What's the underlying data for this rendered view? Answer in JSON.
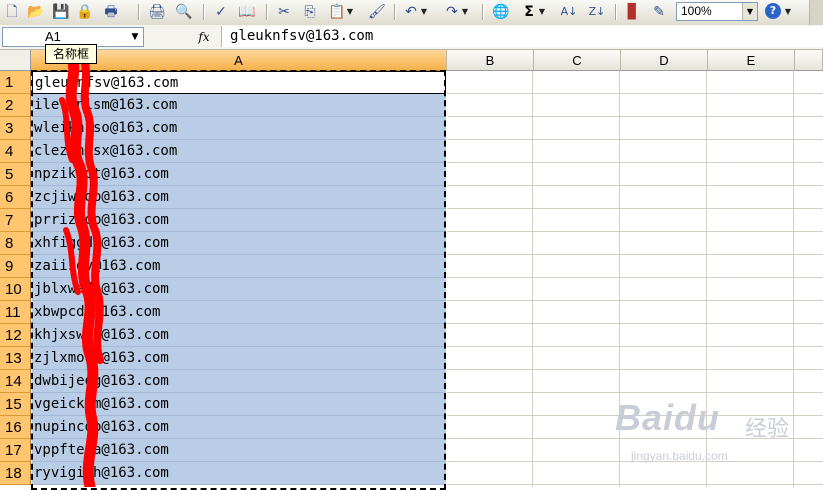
{
  "toolbar": {
    "zoom_value": "100%",
    "help_icon": "help-icon",
    "icons": [
      "new-icon",
      "open-icon",
      "save-icon",
      "permission-icon",
      "print-preview-icon",
      "print-icon",
      "preview-icon",
      "spelling-icon",
      "research-icon",
      "cut-icon",
      "copy-icon",
      "paste-icon",
      "format-painter-icon",
      "undo-icon",
      "redo-icon",
      "hyperlink-icon",
      "autosum-icon",
      "sort-asc-icon",
      "sort-desc-icon",
      "chart-icon",
      "drawing-icon"
    ]
  },
  "formula_bar": {
    "name_box_value": "A1",
    "fx_label": "fx",
    "formula_value": "gleuknfsv@163.com"
  },
  "tooltip": {
    "text": "名称框"
  },
  "columns": [
    "A",
    "B",
    "C",
    "D",
    "E"
  ],
  "rows": [
    {
      "num": "1",
      "value": "gleuknfsv@163.com"
    },
    {
      "num": "2",
      "value": "ilelknlsm@163.com"
    },
    {
      "num": "3",
      "value": "wleiknpso@163.com"
    },
    {
      "num": "4",
      "value": "clezknesx@163.com"
    },
    {
      "num": "5",
      "value": "npzikadt@163.com"
    },
    {
      "num": "6",
      "value": "zcjiwedo@163.com"
    },
    {
      "num": "7",
      "value": "prrizjdp@163.com"
    },
    {
      "num": "8",
      "value": "xhfiggdr@163.com"
    },
    {
      "num": "9",
      "value": "zaiisdv@163.com"
    },
    {
      "num": "10",
      "value": "jblxwadh@163.com"
    },
    {
      "num": "11",
      "value": "xbwpcdt@163.com"
    },
    {
      "num": "12",
      "value": "khjxswdx@163.com"
    },
    {
      "num": "13",
      "value": "zjlxmodt@163.com"
    },
    {
      "num": "14",
      "value": "dwbijedg@163.com"
    },
    {
      "num": "15",
      "value": "vgeickdm@163.com"
    },
    {
      "num": "16",
      "value": "nupincdp@163.com"
    },
    {
      "num": "17",
      "value": "vppfteda@163.com"
    },
    {
      "num": "18",
      "value": "ryvigidh@163.com"
    }
  ],
  "watermark": {
    "logo": "Baidu",
    "cn": "经验",
    "url": "jingyan.baidu.com"
  },
  "colors": {
    "selection": "#b9cde6",
    "row_header_active": "#ffc56f",
    "scribble": "#ff0000"
  }
}
